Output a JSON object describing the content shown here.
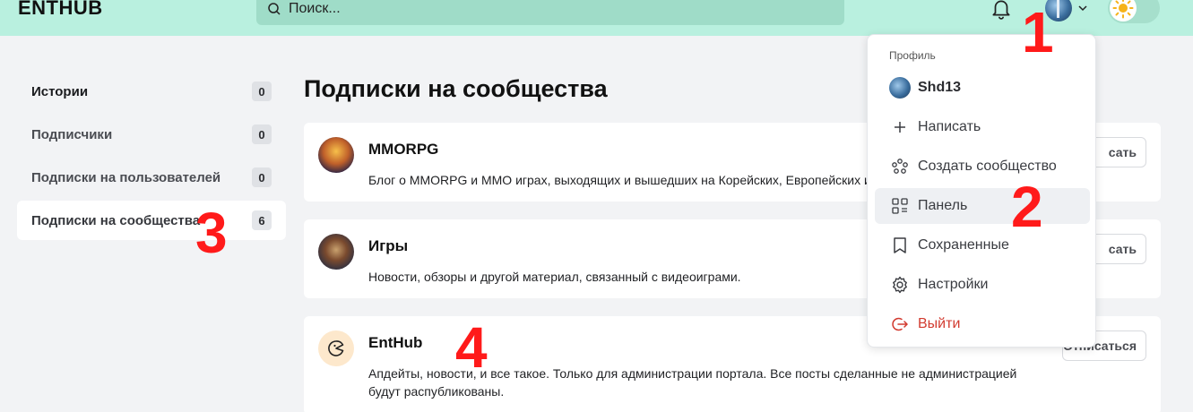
{
  "header": {
    "logo": "ENTHUB",
    "search_placeholder": "Поиск...",
    "accent_color": "#b9f0df"
  },
  "sidebar": {
    "items": [
      {
        "label": "Истории",
        "count": "0"
      },
      {
        "label": "Подписчики",
        "count": "0"
      },
      {
        "label": "Подписки на пользователей",
        "count": "0"
      },
      {
        "label": "Подписки на сообщества",
        "count": "6"
      }
    ]
  },
  "main": {
    "title": "Подписки на сообщества",
    "communities": [
      {
        "name": "MMORPG",
        "description": "Блог о MMORPG и MMO играх, выходящих и вышедших на Корейских, Европейских и",
        "button": "сать"
      },
      {
        "name": "Игры",
        "description": "Новости, обзоры и другой материал, связанный с видеоиграми.",
        "button": "сать"
      },
      {
        "name": "EntHub",
        "description": "Апдейты, новости, и все такое. Только для администрации портала. Все посты сделанные не администрацией будут распубликованы.",
        "button": "Отписаться"
      }
    ]
  },
  "dropdown": {
    "section_label": "Профиль",
    "username": "Shd13",
    "items": {
      "write": "Написать",
      "create_community": "Создать сообщество",
      "panel": "Панель",
      "saved": "Сохраненные",
      "settings": "Настройки",
      "logout": "Выйти"
    },
    "logout_color": "#d23b30"
  },
  "annotations": [
    "1",
    "2",
    "3",
    "4"
  ]
}
